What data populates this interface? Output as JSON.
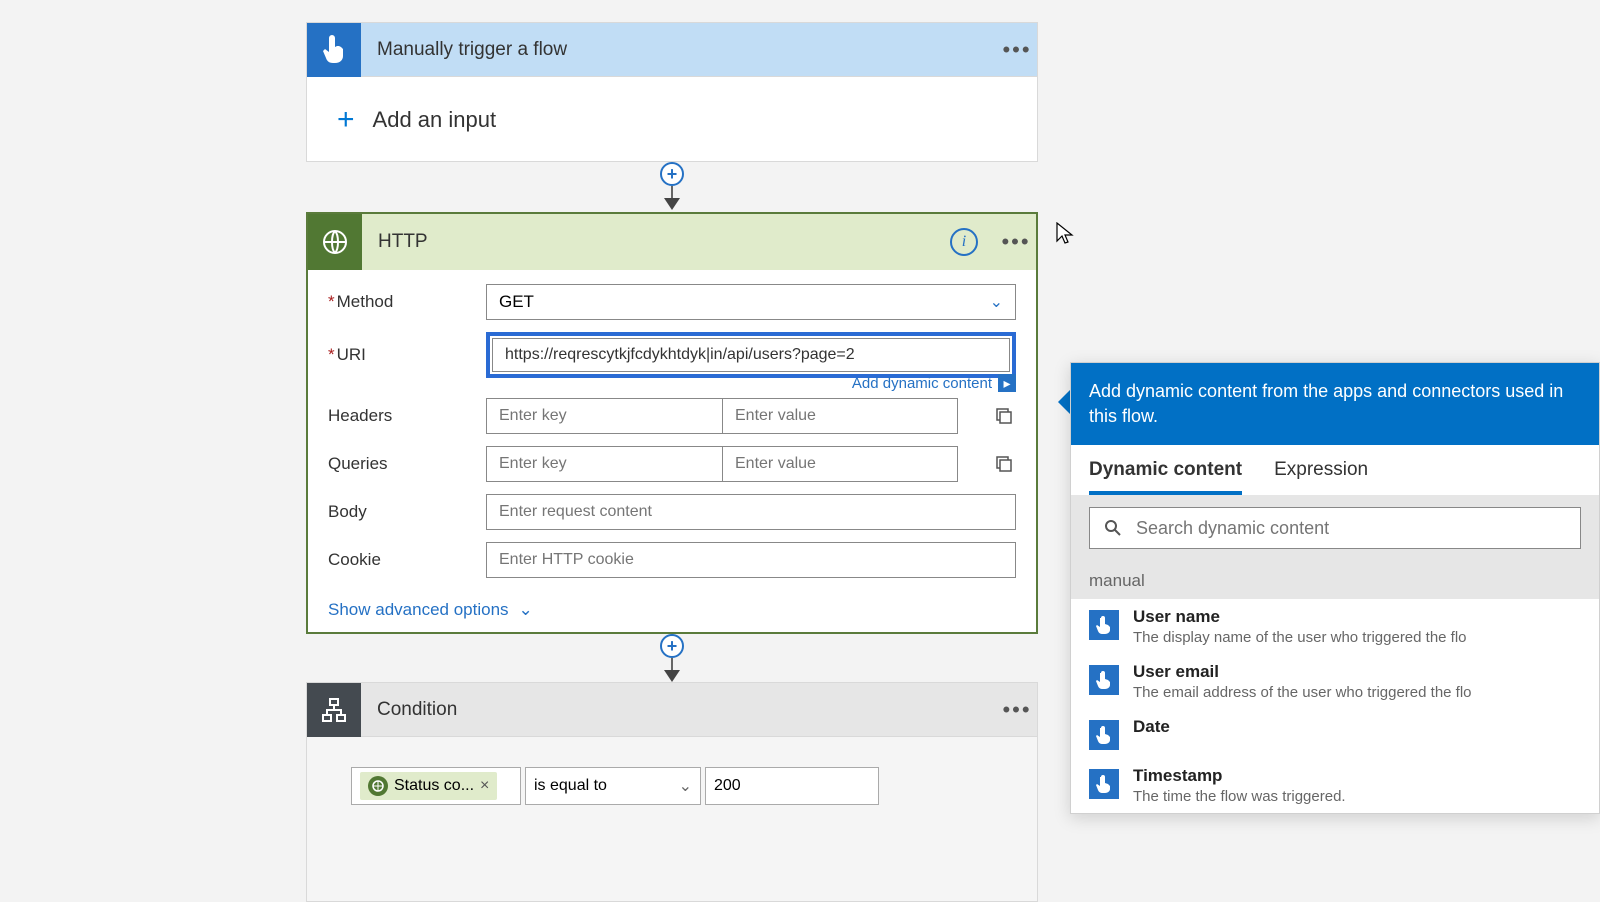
{
  "trigger": {
    "title": "Manually trigger a flow",
    "add_input": "Add an input"
  },
  "http": {
    "title": "HTTP",
    "labels": {
      "method": "Method",
      "uri": "URI",
      "headers": "Headers",
      "queries": "Queries",
      "body": "Body",
      "cookie": "Cookie"
    },
    "method_value": "GET",
    "uri_value": "https://reqrescytkjfcdykhtdyk|in/api/users?page=2",
    "placeholders": {
      "key": "Enter key",
      "value": "Enter value",
      "body": "Enter request content",
      "cookie": "Enter HTTP cookie"
    },
    "add_dynamic": "Add dynamic content",
    "advanced": "Show advanced options"
  },
  "condition": {
    "title": "Condition",
    "token": "Status co...",
    "operator": "is equal to",
    "value": "200"
  },
  "dc": {
    "header": "Add dynamic content from the apps and connectors used in this flow.",
    "tabs": {
      "dynamic": "Dynamic content",
      "expression": "Expression"
    },
    "search_placeholder": "Search dynamic content",
    "group": "manual",
    "items": [
      {
        "name": "User name",
        "desc": "The display name of the user who triggered the flo"
      },
      {
        "name": "User email",
        "desc": "The email address of the user who triggered the flo"
      },
      {
        "name": "Date",
        "desc": ""
      },
      {
        "name": "Timestamp",
        "desc": "The time the flow was triggered."
      }
    ]
  }
}
